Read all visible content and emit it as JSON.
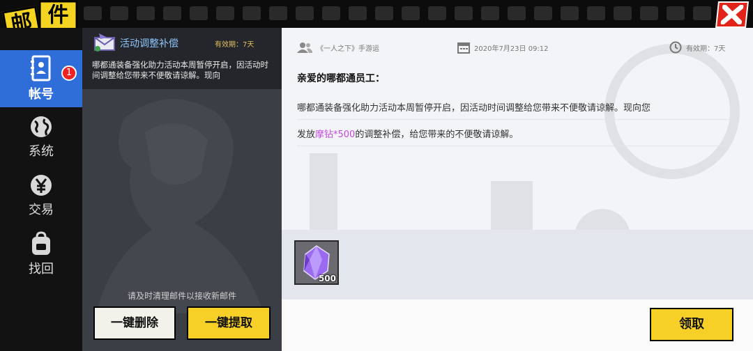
{
  "header": {
    "title_char_1": "邮",
    "title_char_2": "件"
  },
  "close": {
    "icon": "close-icon"
  },
  "sidebar": {
    "items": [
      {
        "label": "帐号",
        "icon": "contacts-book-icon",
        "badge": "1",
        "active": true
      },
      {
        "label": "系统",
        "icon": "globe-icon"
      },
      {
        "label": "交易",
        "icon": "yen-icon"
      },
      {
        "label": "找回",
        "icon": "backpack-icon"
      }
    ]
  },
  "mail_list": {
    "items": [
      {
        "title": "活动调整补偿",
        "validity": "有效期：7天",
        "preview": "哪都通装备强化助力活动本周暂停开启，因活动时间调整给您带来不便敬请谅解。现向"
      }
    ],
    "hint": "请及时清理邮件以接收新邮件",
    "delete_all_label": "一键删除",
    "claim_all_label": "一键提取"
  },
  "detail": {
    "sender": "《一人之下》手游运",
    "date": "2020年7月23日  09:12",
    "validity": "有效期：7天",
    "greeting": "亲爱的哪都通员工：",
    "line1": "哪都通装备强化助力活动本周暂停开启，因活动时间调整给您带来不便敬请谅解。现向您",
    "line2_prefix": "发放",
    "line2_highlight": "摩钻*500",
    "line2_suffix": "的调整补偿，给您带来的不便敬请谅解。",
    "attachment": {
      "icon": "purple-crystal-icon",
      "quantity": "500"
    },
    "claim_label": "领取"
  },
  "colors": {
    "accent_blue": "#2f6ed8",
    "button_yellow": "#f6d027",
    "close_red": "#e2231a",
    "highlight_purple": "#c44adf"
  }
}
